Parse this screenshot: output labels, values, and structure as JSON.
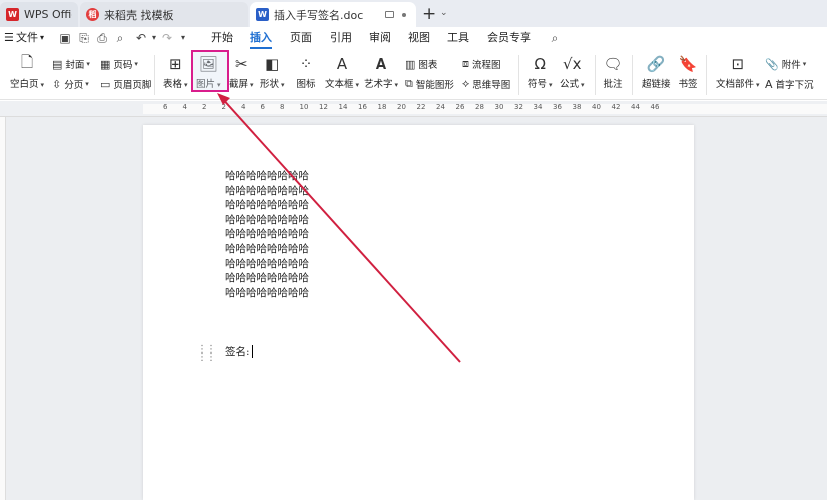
{
  "tabs": [
    {
      "label": "WPS Office",
      "icon": "wps-logo-icon"
    },
    {
      "label": "来稻壳 找模板",
      "icon": "daoke-logo-icon"
    },
    {
      "label": "插入手写签名.doc",
      "icon": "word-doc-icon"
    }
  ],
  "menu": {
    "file": "文件",
    "items": [
      "开始",
      "插入",
      "页面",
      "引用",
      "审阅",
      "视图",
      "工具",
      "会员专享"
    ],
    "active": "插入"
  },
  "ribbon": {
    "blank_page": "空白页",
    "cover": "封面",
    "page_number": "页码",
    "section": "分页",
    "header_footer": "页眉页脚",
    "table": "表格",
    "picture": "图片",
    "screenshot": "截屏",
    "shape": "形状",
    "icon": "图标",
    "textbox": "文本框",
    "wordart": "艺术字",
    "chart": "图表",
    "smart_graphic": "智能图形",
    "flowchart": "流程图",
    "mindmap": "思维导图",
    "symbol": "符号",
    "formula": "公式",
    "comment": "批注",
    "hyperlink": "超链接",
    "bookmark": "书签",
    "doc_parts": "文档部件",
    "attachment": "附件",
    "drop_cap": "首字下沉"
  },
  "ruler": {
    "numbers": [
      "6",
      "4",
      "2",
      "2",
      "4",
      "6",
      "8",
      "10",
      "12",
      "14",
      "16",
      "18",
      "20",
      "22",
      "24",
      "26",
      "28",
      "30",
      "32",
      "34",
      "36",
      "38",
      "40",
      "42",
      "44",
      "46"
    ]
  },
  "document": {
    "lines": [
      "哈哈哈哈哈哈哈哈",
      "哈哈哈哈哈哈哈哈",
      "哈哈哈哈哈哈哈哈",
      "哈哈哈哈哈哈哈哈",
      "哈哈哈哈哈哈哈哈",
      "哈哈哈哈哈哈哈哈",
      "哈哈哈哈哈哈哈哈",
      "哈哈哈哈哈哈哈哈",
      "哈哈哈哈哈哈哈哈"
    ],
    "signature_label": "签名:"
  },
  "colors": {
    "accent": "#1f6fd1",
    "highlight_box": "#d91d8c",
    "annotation_arrow": "#d02040"
  }
}
